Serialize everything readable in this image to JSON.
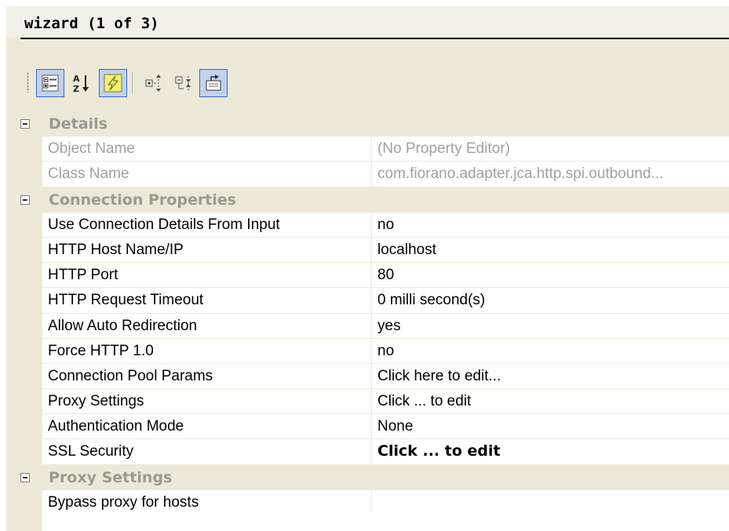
{
  "window": {
    "title": "wizard (1 of 3)"
  },
  "toolbar": {
    "buttons": [
      {
        "icon": "categorized-view-icon",
        "active": true
      },
      {
        "icon": "alphabetical-sort-icon",
        "active": false
      },
      {
        "icon": "events-lightning-icon",
        "active": true
      },
      {
        "icon": "expand-all-icon",
        "active": false
      },
      {
        "icon": "collapse-all-icon",
        "active": false
      },
      {
        "icon": "property-pages-icon",
        "active": true
      }
    ]
  },
  "grid": {
    "categories": [
      {
        "label": "Details",
        "rows": [
          {
            "name": "Object Name",
            "value": "(No Property Editor)",
            "disabled": true
          },
          {
            "name": "Class Name",
            "value": "com.fiorano.adapter.jca.http.spi.outbound...",
            "disabled": true
          }
        ]
      },
      {
        "label": "Connection Properties",
        "rows": [
          {
            "name": "Use Connection Details From Input",
            "value": "no"
          },
          {
            "name": "HTTP Host Name/IP",
            "value": "localhost"
          },
          {
            "name": "HTTP Port",
            "value": "80"
          },
          {
            "name": "HTTP Request Timeout",
            "value": "0 milli second(s)"
          },
          {
            "name": "Allow Auto Redirection",
            "value": "yes"
          },
          {
            "name": "Force HTTP 1.0",
            "value": "no"
          },
          {
            "name": "Connection Pool Params",
            "value": "Click here to edit..."
          },
          {
            "name": "Proxy Settings",
            "value": "Click ... to edit"
          },
          {
            "name": "Authentication Mode",
            "value": "None"
          },
          {
            "name": "SSL Security",
            "value": "Click ... to edit",
            "bold": true
          }
        ]
      },
      {
        "label": "Proxy Settings",
        "rows": [
          {
            "name": "Bypass proxy for hosts",
            "value": ""
          }
        ]
      }
    ]
  }
}
